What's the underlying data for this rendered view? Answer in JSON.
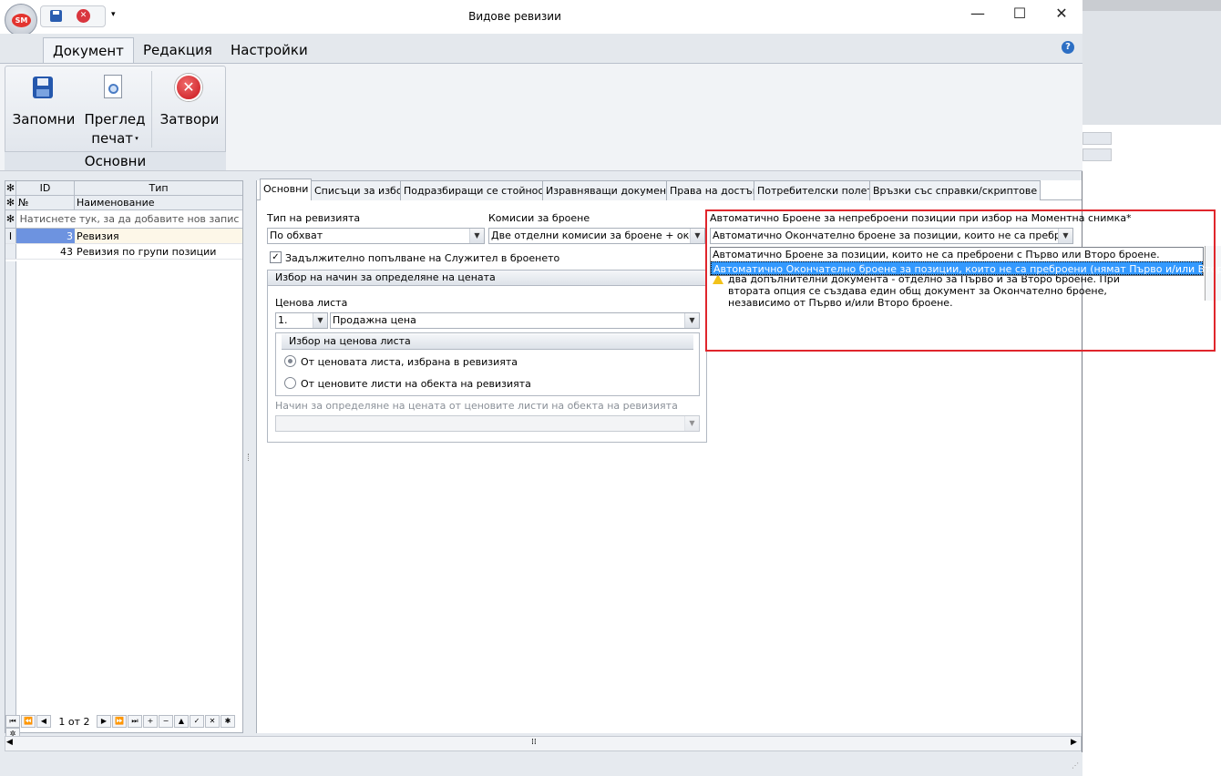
{
  "window": {
    "title": "Видове ревизии",
    "app_orb_text": "SM",
    "minimize": "—",
    "maximize": "☐",
    "close": "✕"
  },
  "ribbon": {
    "tabs": [
      "Документ",
      "Редакция",
      "Настройки"
    ],
    "help": "?",
    "group_label": "Основни",
    "buttons": {
      "save": "Запомни",
      "preview_line1": "Преглед",
      "preview_line2": "печат",
      "close": "Затвори"
    }
  },
  "grid": {
    "headers": {
      "id": "ID",
      "type": "Тип",
      "no": "№",
      "name": "Наименование"
    },
    "new_row_hint": "Натиснете тук, за да добавите нов запис",
    "rows": [
      {
        "id": "3",
        "name": "Ревизия"
      },
      {
        "id": "43",
        "name": "Ревизия по групи позиции"
      }
    ],
    "nav_text": "1 от 2"
  },
  "tabs": [
    "Основни",
    "Списъци за избор",
    "Подразбиращи се стойности",
    "Изравняващи документи",
    "Права на достъп",
    "Потребителски полета",
    "Връзки със справки/скриптове"
  ],
  "form": {
    "audit_type_label": "Тип на ревизията",
    "audit_type_value": "По обхват",
    "counting_label": "Комисии за броене",
    "counting_value": "Две отделни комисии за броене + окончат",
    "mandatory_checkbox": "Задължително попълване на Служител в броенето",
    "price_group_title": "Избор на начин за определяне на цената",
    "price_list_label": "Ценова листа",
    "price_list_no": "1.",
    "price_list_value": "Продажна цена",
    "price_list_subgroup": "Избор на ценова листа",
    "radio1": "От ценовата листа, избрана в ревизията",
    "radio2": "От ценовите листи на обекта на ревизията",
    "method_label": "Начин за определяне на цената от ценовите листи на обекта на ревизията",
    "auto_label": "Автоматично Броене за непреброени позиции при избор на Моментна снимка*",
    "auto_value": "Автоматично Окончателно броене за позиции, които не са преброени (ня",
    "dropdown_options": [
      "Автоматично Броене за позиции, които не са преброени с Първо или Второ броене.",
      "Автоматично Окончателно броене за позиции, които не са преброени (нямат Първо и/или Второ Броене)"
    ],
    "note_line1": "два допълнителни документа - отделно за Първо и за Второ броене. При",
    "note_line2": "втората опция се създава един общ документ за Окончателно броене,",
    "note_line3": "независимо от Първо и/или Второ броене."
  },
  "colors": {
    "accent_selection": "#3399ff",
    "highlight_border": "#e0262c"
  }
}
